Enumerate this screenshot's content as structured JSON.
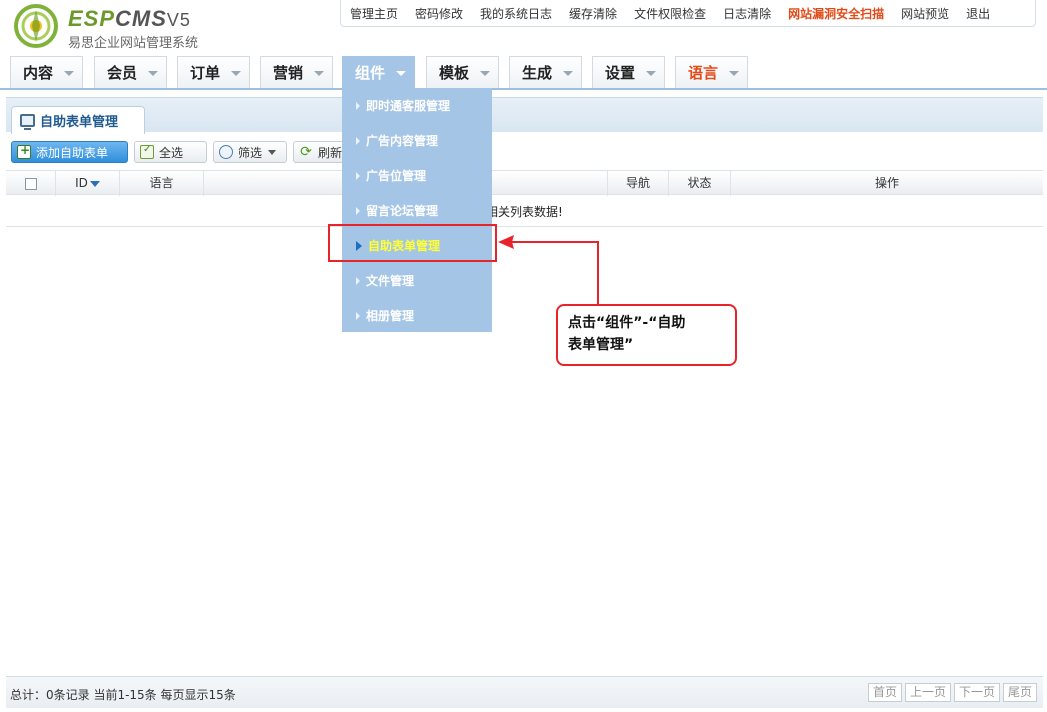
{
  "logo": {
    "brand_green": "ESP",
    "brand_grey": "CMS",
    "version": "V5",
    "subtitle": "易思企业网站管理系统"
  },
  "top_links": [
    {
      "label": "管理主页",
      "danger": false
    },
    {
      "label": "密码修改",
      "danger": false
    },
    {
      "label": "我的系统日志",
      "danger": false
    },
    {
      "label": "缓存清除",
      "danger": false
    },
    {
      "label": "文件权限检查",
      "danger": false
    },
    {
      "label": "日志清除",
      "danger": false
    },
    {
      "label": "网站漏洞安全扫描",
      "danger": true
    },
    {
      "label": "网站预览",
      "danger": false
    },
    {
      "label": "退出",
      "danger": false
    }
  ],
  "nav": [
    {
      "label": "内容"
    },
    {
      "label": "会员"
    },
    {
      "label": "订单"
    },
    {
      "label": "营销"
    },
    {
      "label": "组件",
      "active": true
    },
    {
      "label": "模板"
    },
    {
      "label": "生成"
    },
    {
      "label": "设置"
    },
    {
      "label": "语言"
    }
  ],
  "dropdown": [
    {
      "label": "即时通客服管理"
    },
    {
      "label": "广告内容管理"
    },
    {
      "label": "广告位管理"
    },
    {
      "label": "留言论坛管理"
    },
    {
      "label": "自助表单管理",
      "current": true
    },
    {
      "label": "文件管理"
    },
    {
      "label": "相册管理"
    }
  ],
  "tab": {
    "label": "自助表单管理"
  },
  "toolbar": {
    "add": "添加自助表单",
    "select_all": "全选",
    "filter": "筛选",
    "refresh": "刷新"
  },
  "grid": {
    "columns": {
      "id": "ID",
      "language": "语言",
      "nav": "导航",
      "status": "状态",
      "ops": "操作"
    },
    "empty_message": "相关列表数据!"
  },
  "annotation": {
    "line1": "点击“组件”-“自助",
    "line2": "表单管理”"
  },
  "footer": {
    "info": "总计：0条记录 当前1-15条 每页显示15条",
    "pager": [
      "首页",
      "上一页",
      "下一页",
      "尾页"
    ]
  },
  "colors": {
    "menu_bg": "#a5c5e6",
    "highlight": "#e8242b",
    "danger_link": "#e04b1a",
    "current_item": "#ffff33"
  }
}
